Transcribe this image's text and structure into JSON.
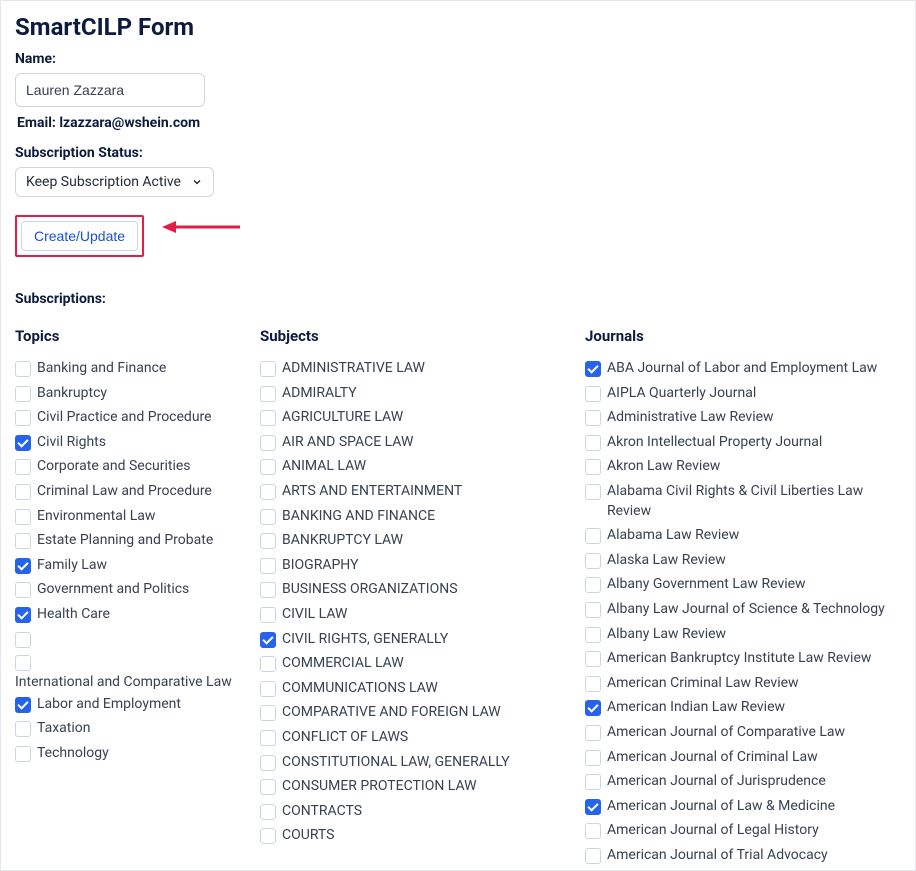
{
  "title": "SmartCILP Form",
  "name_label": "Name:",
  "name_value": "Lauren Zazzara",
  "email_label": "Email:",
  "email_value": "lzazzara@wshein.com",
  "status_label": "Subscription Status:",
  "status_value": "Keep Subscription Active",
  "create_btn": "Create/Update",
  "subs_label": "Subscriptions:",
  "heads": {
    "topics": "Topics",
    "subjects": "Subjects",
    "journals": "Journals"
  },
  "topics": [
    {
      "label": "Banking and Finance",
      "checked": false
    },
    {
      "label": "Bankruptcy",
      "checked": false
    },
    {
      "label": "Civil Practice and Procedure",
      "checked": false
    },
    {
      "label": "Civil Rights",
      "checked": true
    },
    {
      "label": "Corporate and Securities",
      "checked": false
    },
    {
      "label": "Criminal Law and Procedure",
      "checked": false
    },
    {
      "label": "Environmental Law",
      "checked": false
    },
    {
      "label": "Estate Planning and Probate",
      "checked": false
    },
    {
      "label": "Family Law",
      "checked": true
    },
    {
      "label": "Government and Politics",
      "checked": false
    },
    {
      "label": "Health Care",
      "checked": true
    },
    {
      "label": "",
      "checked": false
    },
    {
      "label": "International and Comparative Law",
      "checked": false,
      "wrap": true
    },
    {
      "label": "Labor and Employment",
      "checked": true
    },
    {
      "label": "Taxation",
      "checked": false
    },
    {
      "label": "Technology",
      "checked": false
    }
  ],
  "subjects": [
    {
      "label": "ADMINISTRATIVE LAW",
      "checked": false
    },
    {
      "label": "ADMIRALTY",
      "checked": false
    },
    {
      "label": "AGRICULTURE LAW",
      "checked": false
    },
    {
      "label": "AIR AND SPACE LAW",
      "checked": false
    },
    {
      "label": "ANIMAL LAW",
      "checked": false
    },
    {
      "label": "ARTS AND ENTERTAINMENT",
      "checked": false
    },
    {
      "label": "BANKING AND FINANCE",
      "checked": false
    },
    {
      "label": "BANKRUPTCY LAW",
      "checked": false
    },
    {
      "label": "BIOGRAPHY",
      "checked": false
    },
    {
      "label": "BUSINESS ORGANIZATIONS",
      "checked": false
    },
    {
      "label": "CIVIL LAW",
      "checked": false
    },
    {
      "label": "CIVIL RIGHTS, GENERALLY",
      "checked": true
    },
    {
      "label": "COMMERCIAL LAW",
      "checked": false
    },
    {
      "label": "COMMUNICATIONS LAW",
      "checked": false
    },
    {
      "label": "COMPARATIVE AND FOREIGN LAW",
      "checked": false
    },
    {
      "label": "CONFLICT OF LAWS",
      "checked": false
    },
    {
      "label": "CONSTITUTIONAL LAW, GENERALLY",
      "checked": false
    },
    {
      "label": "CONSUMER PROTECTION LAW",
      "checked": false
    },
    {
      "label": "CONTRACTS",
      "checked": false
    },
    {
      "label": "COURTS",
      "checked": false
    }
  ],
  "journals": [
    {
      "label": "ABA Journal of Labor and Employment Law",
      "checked": true
    },
    {
      "label": "AIPLA Quarterly Journal",
      "checked": false
    },
    {
      "label": "Administrative Law Review",
      "checked": false
    },
    {
      "label": "Akron Intellectual Property Journal",
      "checked": false
    },
    {
      "label": "Akron Law Review",
      "checked": false
    },
    {
      "label": "Alabama Civil Rights & Civil Liberties Law Review",
      "checked": false
    },
    {
      "label": "Alabama Law Review",
      "checked": false
    },
    {
      "label": "Alaska Law Review",
      "checked": false
    },
    {
      "label": "Albany Government Law Review",
      "checked": false
    },
    {
      "label": "Albany Law Journal of Science & Technology",
      "checked": false
    },
    {
      "label": "Albany Law Review",
      "checked": false
    },
    {
      "label": "American Bankruptcy Institute Law Review",
      "checked": false
    },
    {
      "label": "American Criminal Law Review",
      "checked": false
    },
    {
      "label": "American Indian Law Review",
      "checked": true
    },
    {
      "label": "American Journal of Comparative Law",
      "checked": false
    },
    {
      "label": "American Journal of Criminal Law",
      "checked": false
    },
    {
      "label": "American Journal of Jurisprudence",
      "checked": false
    },
    {
      "label": "American Journal of Law & Medicine",
      "checked": true
    },
    {
      "label": "American Journal of Legal History",
      "checked": false
    },
    {
      "label": "American Journal of Trial Advocacy",
      "checked": false
    }
  ],
  "colors": {
    "highlight": "#e11d48",
    "checkbox_on": "#2563eb"
  }
}
